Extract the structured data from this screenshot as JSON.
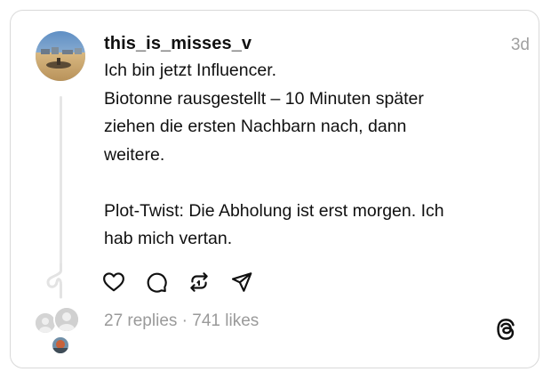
{
  "post": {
    "username": "this_is_misses_v",
    "timestamp": "3d",
    "text_lines": [
      "Ich bin jetzt Influencer.",
      "Biotonne rausgestellt – 10 Minuten später",
      "ziehen die ersten Nachbarn nach, dann",
      "weitere.",
      "Plot-Twist: Die Abholung ist erst morgen. Ich",
      "hab mich vertan."
    ]
  },
  "actions": {
    "like_icon": "heart-icon",
    "reply_icon": "comment-icon",
    "repost_icon": "repost-icon",
    "share_icon": "send-icon"
  },
  "footer": {
    "replies_count": "27 replies",
    "separator": "·",
    "likes_count": "741 likes",
    "brand_icon": "threads-logo-icon"
  },
  "colors": {
    "text": "#101010",
    "muted": "#9a9a9a",
    "border": "#d9d9d9"
  }
}
